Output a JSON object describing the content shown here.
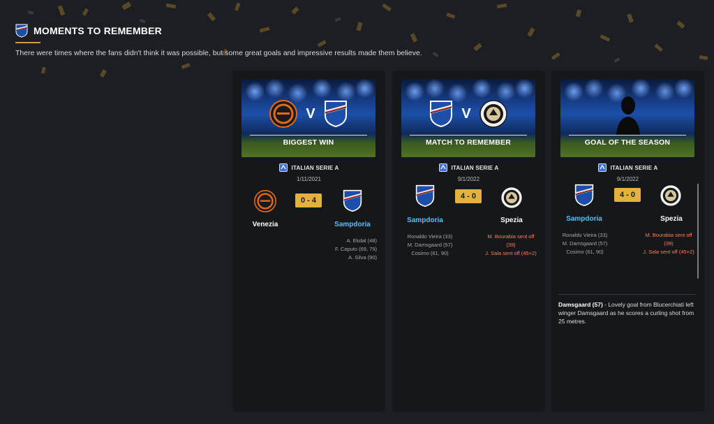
{
  "header": {
    "title": "MOMENTS TO REMEMBER",
    "subtitle": "There were times where the fans didn't think it was possible, but some great goals and impressive results made them believe."
  },
  "cards": [
    {
      "banner_label": "BIGGEST WIN",
      "vs": "V",
      "competition": "ITALIAN SERIE A",
      "date": "1/11/2021",
      "score": "0 - 4",
      "home": "Venezia",
      "away": "Sampdoria",
      "away_scorers": [
        "A. Ekdal (48)",
        "F. Caputo (69, 75)",
        "A. Silva (90)"
      ]
    },
    {
      "banner_label": "MATCH TO REMEMBER",
      "vs": "V",
      "competition": "ITALIAN SERIE A",
      "date": "9/1/2022",
      "score": "4 - 0",
      "home": "Sampdoria",
      "away": "Spezia",
      "home_scorers": [
        "Ronaldo Vieira (33)",
        "M. Damsgaard (57)",
        "Cosimo (61, 90)"
      ],
      "away_events": [
        "M. Bourabia sent off",
        "(39)",
        "J. Sala sent off (45+2)"
      ]
    },
    {
      "banner_label": "GOAL OF THE SEASON",
      "competition": "ITALIAN SERIE A",
      "date": "9/1/2022",
      "score": "4 - 0",
      "home": "Sampdoria",
      "away": "Spezia",
      "home_scorers": [
        "Ronaldo Vieira (33)",
        "M. Damsgaard (57)",
        "Cosimo (61, 90)"
      ],
      "away_events": [
        "M. Bourabia sent off",
        "(39)",
        "J. Sala sent off (45+2)"
      ],
      "goal_scorer": "Damsgaard (57)",
      "goal_description": " - Lovely goal from Blucerchiati left winger Damsgaard as he scores a curling shot from 25 metres."
    }
  ],
  "colors": {
    "accent_gold": "#e3b23c",
    "team_blue": "#4fc3f7",
    "event_red": "#ff7f50",
    "card_bg": "#15171b",
    "page_bg": "#1c1e23"
  },
  "icons": {
    "sampdoria": "sampdoria-crest-icon",
    "venezia": "venezia-crest-icon",
    "spezia": "spezia-crest-icon",
    "serie_a": "serie-a-icon",
    "player": "player-silhouette-icon"
  }
}
